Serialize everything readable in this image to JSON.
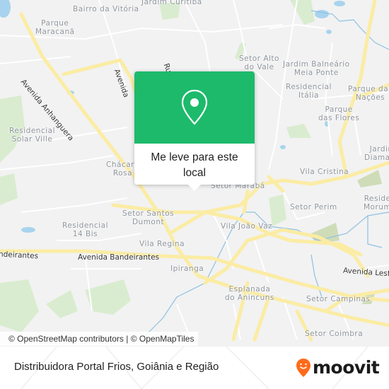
{
  "map": {
    "place_labels": [
      {
        "text": "Bairro da Vitória"
      },
      {
        "text": "Jardim Curitiba"
      },
      {
        "text": "Parque\nMaracanã"
      },
      {
        "text": "Setor Alto\ndo Vale"
      },
      {
        "text": "Jardim Balneário\nMeia Ponte"
      },
      {
        "text": "Residencial\nItália"
      },
      {
        "text": "Parque das\nNações"
      },
      {
        "text": "Parque\ndas Flores"
      },
      {
        "text": "Residencial\nSolar Ville"
      },
      {
        "text": "Jardim\nDiamanti"
      },
      {
        "text": "Chácara\nRosa"
      },
      {
        "text": "Vila Cristina"
      },
      {
        "text": "Setor Marabá"
      },
      {
        "text": "Setor Perim"
      },
      {
        "text": "Reside\nMorum"
      },
      {
        "text": "Setor Santos\nDumont"
      },
      {
        "text": "Residencial\n14 Bis"
      },
      {
        "text": "Vila João Vaz"
      },
      {
        "text": "Vila Regina"
      },
      {
        "text": "Ipiranga"
      },
      {
        "text": "Esplanada\ndo Anincuns"
      },
      {
        "text": "Setor Campinas"
      },
      {
        "text": "Setor Coimbra"
      }
    ],
    "road_labels": [
      {
        "text": "Avenida Anhanguera"
      },
      {
        "text": "Avenida"
      },
      {
        "text": "Ru"
      },
      {
        "text": "Avenida Bandeirantes"
      },
      {
        "text": "ndeirantes"
      },
      {
        "text": "Avenida Lest"
      }
    ],
    "colors": {
      "background": "#f2f2f2",
      "major_road": "#fbeca4",
      "minor_road": "#ffffff",
      "park": "#d9ecd0",
      "water": "#a8d3ee",
      "river": "#8ec1e3"
    }
  },
  "popup": {
    "icon": "map-pin-icon",
    "label": "Me leve para este local",
    "accent": "#1dba6b"
  },
  "attribution": "© OpenStreetMap contributors | © OpenMapTiles",
  "footer": {
    "title": "Distribuidora Portal Frios, Goiânia e Região",
    "brand": "moovit",
    "brand_color": "#ff6b1a"
  }
}
